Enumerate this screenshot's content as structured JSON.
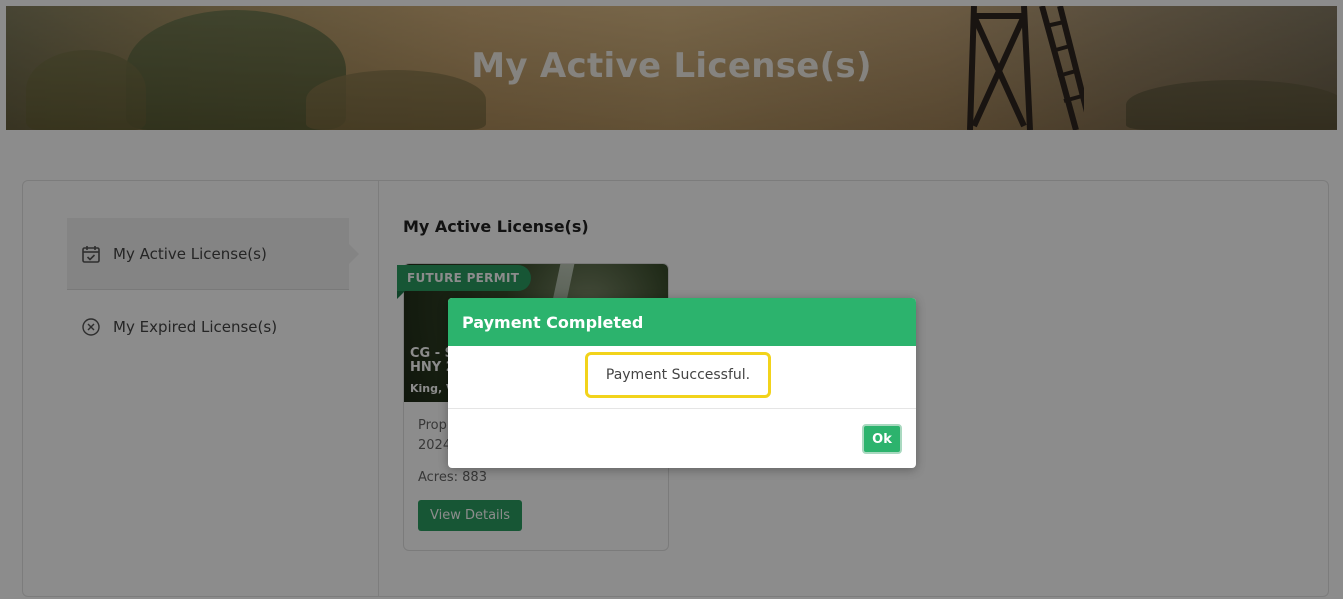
{
  "hero": {
    "title": "My Active License(s)"
  },
  "sidebar": {
    "items": [
      {
        "label": "My Active License(s)",
        "icon": "calendar-check-icon",
        "active": true
      },
      {
        "label": "My Expired License(s)",
        "icon": "circle-x-icon",
        "active": false
      }
    ]
  },
  "main": {
    "title": "My Active License(s)",
    "card": {
      "ribbon": "FUTURE PERMIT",
      "title_line1": "CG - S",
      "title_line2": "HNY 2",
      "subtitle": "King, V",
      "property_line1": "Prop",
      "property_line2": "2024",
      "acres": "Acres: 883",
      "view_button": "View Details"
    }
  },
  "modal": {
    "header": "Payment Completed",
    "message": "Payment Successful.",
    "ok_button": "Ok"
  },
  "colors": {
    "accent_green": "#2cb36d",
    "highlight_yellow": "#f2d31b"
  }
}
